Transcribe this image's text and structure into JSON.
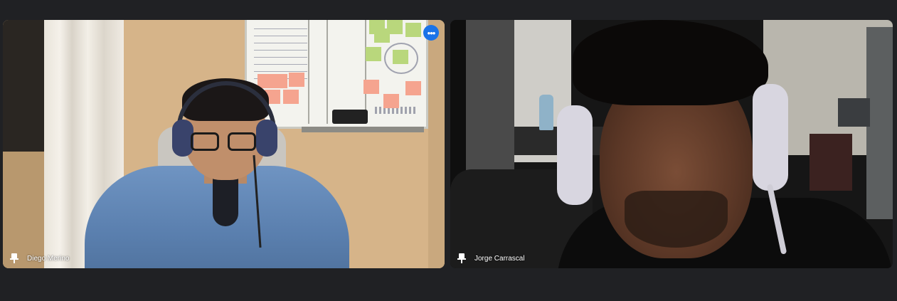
{
  "tiles": [
    {
      "participant_name": "Diego Merino",
      "pinned": true,
      "has_more_options": true,
      "more_options_icon": "more-horiz-icon"
    },
    {
      "participant_name": "Jorge Carrascal",
      "pinned": true,
      "has_more_options": false
    }
  ],
  "colors": {
    "background": "#202124",
    "accent": "#1a73e8",
    "name_text": "#ffffff"
  },
  "icons": {
    "pin": "pin-icon",
    "more": "more-horiz-icon"
  }
}
